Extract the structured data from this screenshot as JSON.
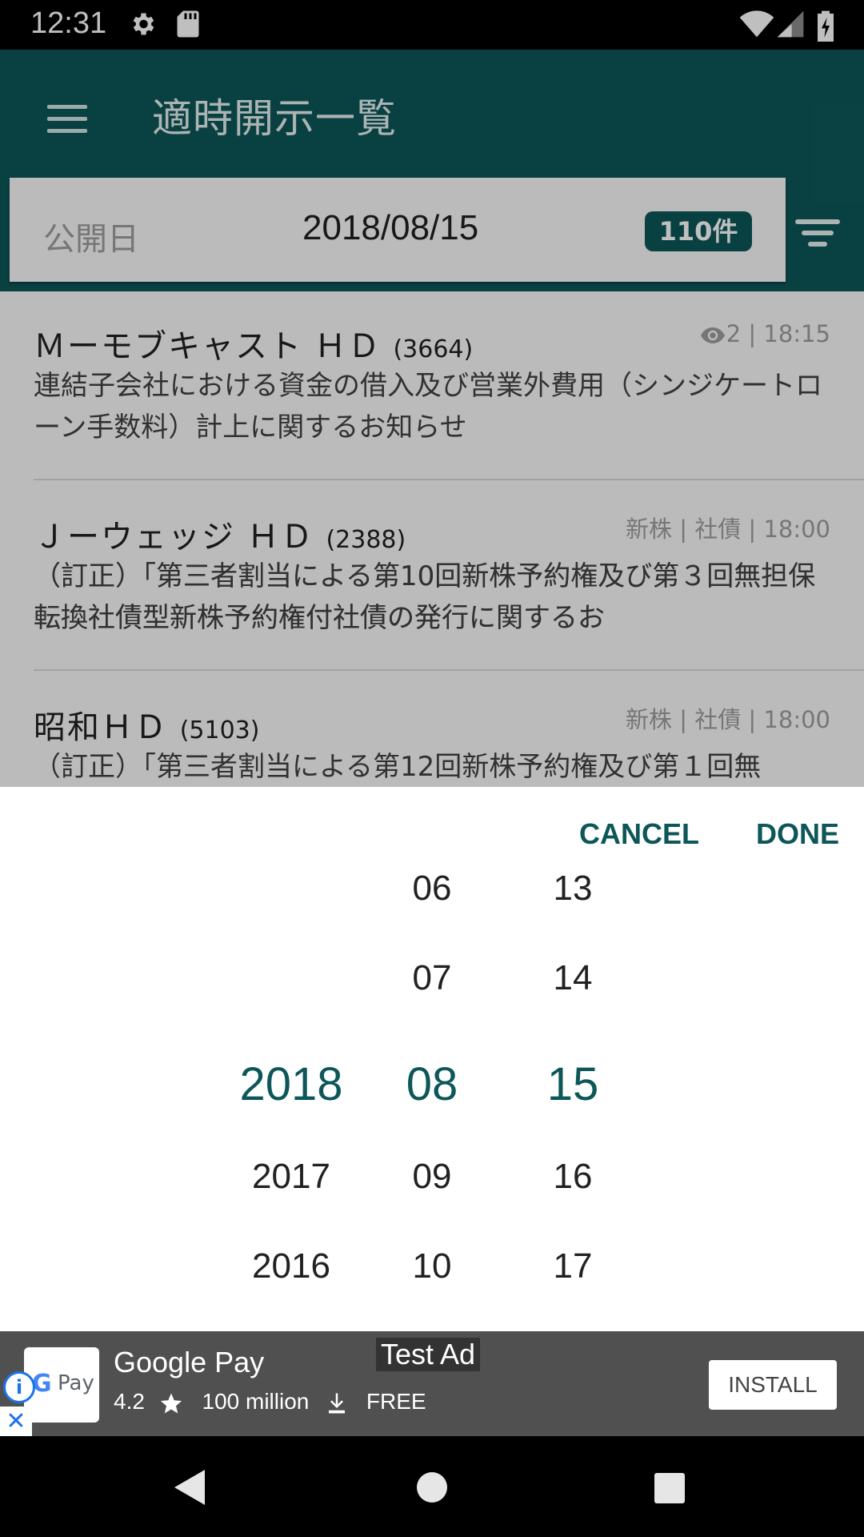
{
  "status_bar": {
    "time": "12:31"
  },
  "app_bar": {
    "title": "適時開示一覧",
    "date_label": "公開日",
    "date_value": "2018/08/15",
    "count_badge": "110件"
  },
  "list": [
    {
      "name": "Ｍーモブキャスト ＨＤ",
      "code": "(3664)",
      "meta": "2 | 18:15",
      "description": "連結子会社における資金の借入及び営業外費用（シンジケートローン手数料）計上に関するお知らせ"
    },
    {
      "name": "Ｊーウェッジ ＨＤ",
      "code": "(2388)",
      "meta": "新株 | 社債 | 18:00",
      "description": "（訂正）「第三者割当による第10回新株予約権及び第３回無担保転換社債型新株予約権付社債の発行に関するお"
    },
    {
      "name": "昭和ＨＤ",
      "code": "(5103)",
      "meta": "新株 | 社債 | 18:00",
      "description": "（訂正）「第三者割当による第12回新株予約権及び第１回無"
    }
  ],
  "picker": {
    "cancel_label": "CANCEL",
    "done_label": "DONE",
    "years": [
      "2018",
      "2017",
      "2016"
    ],
    "months": [
      "06",
      "07",
      "08",
      "09",
      "10"
    ],
    "days": [
      "13",
      "14",
      "15",
      "16",
      "17"
    ],
    "selected": {
      "year": "2018",
      "month": "08",
      "day": "15"
    }
  },
  "ad": {
    "title": "Google Pay",
    "label": "Test Ad",
    "logo_g": "G",
    "logo_text": "Pay",
    "rating": "4.2",
    "downloads": "100 million",
    "price": "FREE",
    "install_label": "INSTALL"
  },
  "colors": {
    "primary": "#0d5759",
    "accent_text": "#0d5759"
  }
}
